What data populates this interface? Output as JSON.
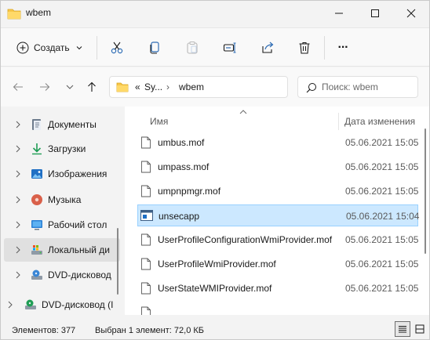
{
  "window": {
    "title": "wbem",
    "accent": "#cce8ff",
    "folder_color": "#f7c64a"
  },
  "toolbar": {
    "create_label": "Создать",
    "icons": [
      "scissors-icon",
      "copy-icon",
      "paste-icon",
      "rename-icon",
      "share-icon",
      "delete-icon",
      "more-icon"
    ],
    "more_label": "···"
  },
  "nav": {
    "breadcrumb": {
      "overflow": "«",
      "parent": "Sy...",
      "separator": "›",
      "current": "wbem"
    },
    "search": {
      "placeholder": "Поиск: wbem",
      "value": ""
    }
  },
  "sidebar": {
    "items": [
      {
        "label": "Документы",
        "icon": "documents-icon"
      },
      {
        "label": "Загрузки",
        "icon": "downloads-icon"
      },
      {
        "label": "Изображения",
        "icon": "pictures-icon"
      },
      {
        "label": "Музыка",
        "icon": "music-icon"
      },
      {
        "label": "Рабочий стол",
        "icon": "desktop-icon"
      },
      {
        "label": "Локальный ди",
        "icon": "local-disk-icon",
        "selected": true
      },
      {
        "label": "DVD-дисковод",
        "icon": "dvd-drive-icon"
      },
      {
        "label": "DVD-дисковод (I",
        "icon": "dvd-drive-icon"
      }
    ]
  },
  "filelist": {
    "columns": {
      "name": "Имя",
      "date": "Дата изменения"
    },
    "rows": [
      {
        "name": "umbus.mof",
        "date": "05.06.2021 15:05",
        "icon": "file-icon"
      },
      {
        "name": "umpass.mof",
        "date": "05.06.2021 15:05",
        "icon": "file-icon"
      },
      {
        "name": "umpnpmgr.mof",
        "date": "05.06.2021 15:05",
        "icon": "file-icon"
      },
      {
        "name": "unsecapp",
        "date": "05.06.2021 15:04",
        "icon": "application-icon",
        "selected": true
      },
      {
        "name": "UserProfileConfigurationWmiProvider.mof",
        "date": "05.06.2021 15:05",
        "icon": "file-icon"
      },
      {
        "name": "UserProfileWmiProvider.mof",
        "date": "05.06.2021 15:05",
        "icon": "file-icon"
      },
      {
        "name": "UserStateWMIProvider.mof",
        "date": "05.06.2021 15:05",
        "icon": "file-icon"
      }
    ]
  },
  "status": {
    "count": "Элементов: 377",
    "selection": "Выбран 1 элемент: 72,0 КБ"
  }
}
